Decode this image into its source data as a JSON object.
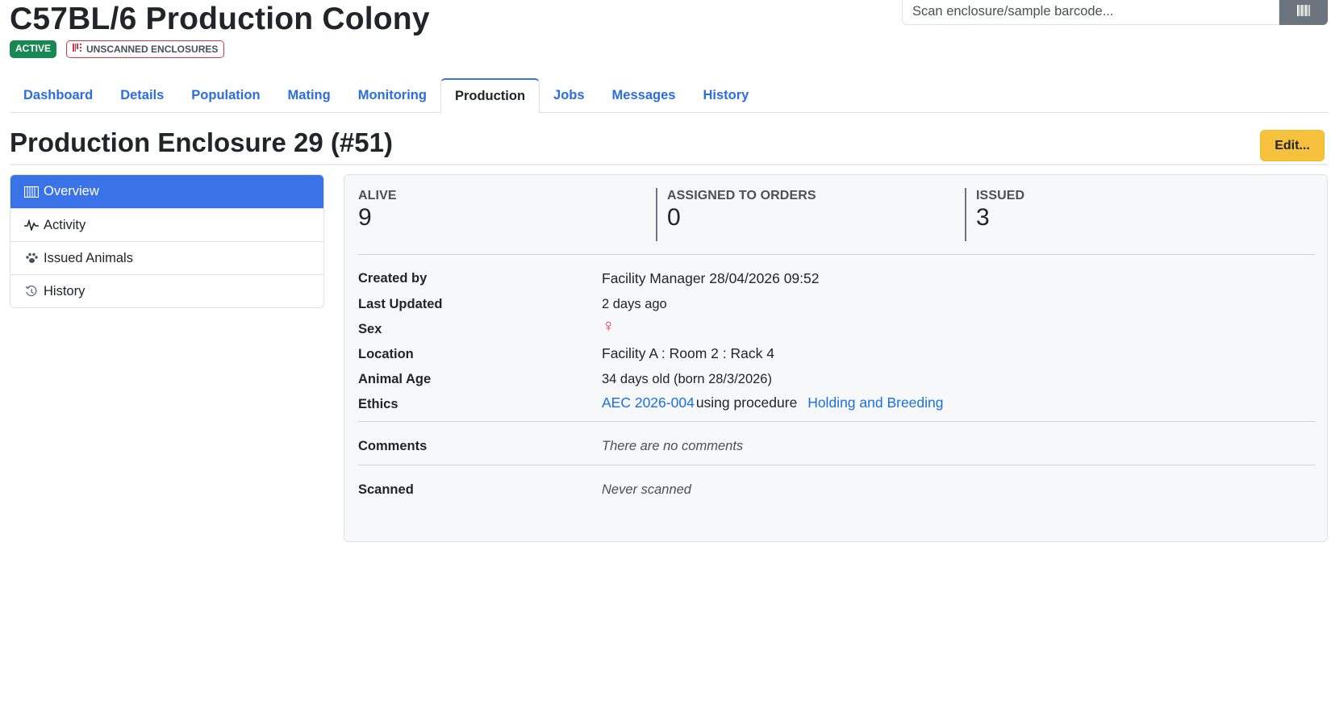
{
  "colony": {
    "title": "C57BL/6 Production Colony",
    "status_badge": "ACTIVE",
    "warning_badge": "UNSCANNED ENCLOSURES"
  },
  "scan": {
    "placeholder": "Scan enclosure/sample barcode..."
  },
  "tabs": [
    {
      "label": "Dashboard",
      "active": false
    },
    {
      "label": "Details",
      "active": false
    },
    {
      "label": "Population",
      "active": false
    },
    {
      "label": "Mating",
      "active": false
    },
    {
      "label": "Monitoring",
      "active": false
    },
    {
      "label": "Production",
      "active": true
    },
    {
      "label": "Jobs",
      "active": false
    },
    {
      "label": "Messages",
      "active": false
    },
    {
      "label": "History",
      "active": false
    }
  ],
  "page": {
    "title": "Production Enclosure 29 (#51)",
    "edit_label": "Edit..."
  },
  "sidebar": {
    "items": [
      {
        "label": "Overview",
        "icon": "enclosure-icon",
        "active": true
      },
      {
        "label": "Activity",
        "icon": "activity-icon",
        "active": false
      },
      {
        "label": "Issued Animals",
        "icon": "paw-icon",
        "active": false
      },
      {
        "label": "History",
        "icon": "history-icon",
        "active": false
      }
    ]
  },
  "stats": {
    "alive": {
      "label": "ALIVE",
      "value": "9"
    },
    "assigned": {
      "label": "ASSIGNED TO ORDERS",
      "value": "0"
    },
    "issued": {
      "label": "ISSUED",
      "value": "3"
    }
  },
  "details": {
    "created_by_label": "Created by",
    "created_by_value": "Facility Manager 28/04/2026 09:52",
    "last_updated_label": "Last Updated",
    "last_updated_value": "2 days ago",
    "sex_label": "Sex",
    "sex_symbol": "♀",
    "location_label": "Location",
    "location_value": "Facility A : Room 2 : Rack 4",
    "age_label": "Animal Age",
    "age_value": "34 days old (born 28/3/2026)",
    "ethics_label": "Ethics",
    "ethics_code": "AEC 2026-004",
    "ethics_using": "using procedure",
    "ethics_procedure": "Holding and Breeding",
    "comments_label": "Comments",
    "comments_value": "There are no comments",
    "scanned_label": "Scanned",
    "scanned_value": "Never scanned"
  },
  "colors": {
    "primary": "#3a73e8",
    "link": "#2b6de4",
    "success": "#198754",
    "danger": "#dc3545",
    "warning": "#f6c23e"
  }
}
